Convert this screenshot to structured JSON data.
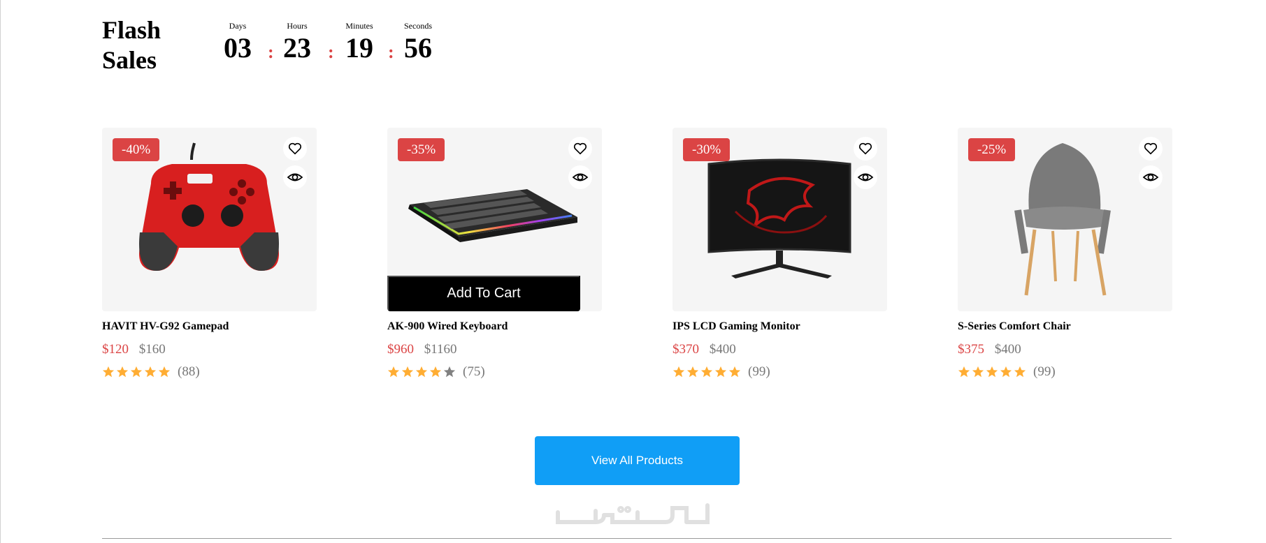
{
  "section": {
    "title": "Flash Sales"
  },
  "countdown": [
    {
      "label": "Days",
      "value": "03"
    },
    {
      "label": "Hours",
      "value": "23"
    },
    {
      "label": "Minutes",
      "value": "19"
    },
    {
      "label": "Seconds",
      "value": "56"
    }
  ],
  "countdown_separator": ":",
  "products": [
    {
      "name": "HAVIT HV-G92 Gamepad",
      "discount": "-40%",
      "price": "$120",
      "old_price": "$160",
      "rating": 5,
      "reviews": "(88)",
      "image": "gamepad"
    },
    {
      "name": "AK-900 Wired Keyboard",
      "discount": "-35%",
      "price": "$960",
      "old_price": "$1160",
      "rating": 4,
      "reviews": "(75)",
      "image": "keyboard",
      "cart_label": "Add To Cart"
    },
    {
      "name": "IPS LCD Gaming Monitor",
      "discount": "-30%",
      "price": "$370",
      "old_price": "$400",
      "rating": 5,
      "reviews": "(99)",
      "image": "monitor"
    },
    {
      "name": "S-Series Comfort Chair",
      "discount": "-25%",
      "price": "$375",
      "old_price": "$400",
      "rating": 5,
      "reviews": "(99)",
      "image": "chair"
    }
  ],
  "card_icons": [
    "heart-icon",
    "eye-icon"
  ],
  "view_all_label": "View All Products",
  "watermark_text": "خمسات",
  "colors": {
    "accent": "#db4444",
    "button": "#109ef6",
    "star": "#ffad33",
    "star_empty": "#808080",
    "card_bg": "#f5f5f5"
  }
}
